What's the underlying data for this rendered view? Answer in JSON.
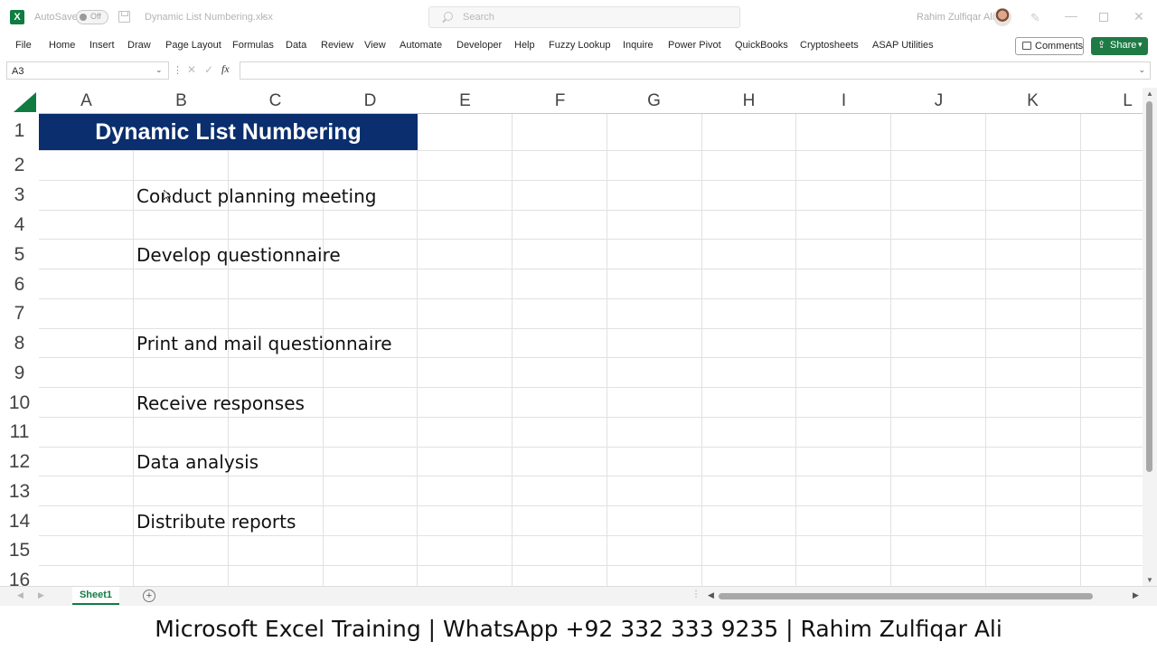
{
  "titlebar": {
    "autosave_label": "AutoSave",
    "autosave_state": "Off",
    "filename": "Dynamic List Numbering.xlsx",
    "search_placeholder": "Search",
    "username": "Rahim Zulfiqar Ali"
  },
  "ribbon": {
    "tabs": [
      "File",
      "Home",
      "Insert",
      "Draw",
      "Page Layout",
      "Formulas",
      "Data",
      "Review",
      "View",
      "Automate",
      "Developer",
      "Help",
      "Fuzzy Lookup",
      "Inquire",
      "Power Pivot",
      "QuickBooks",
      "Cryptosheets",
      "ASAP Utilities"
    ],
    "comments_label": "Comments",
    "share_label": "Share"
  },
  "formula_bar": {
    "name_box": "A3",
    "fx_label": "fx",
    "formula": ""
  },
  "sheet": {
    "columns": [
      "A",
      "B",
      "C",
      "D",
      "E",
      "F",
      "G",
      "H",
      "I",
      "J",
      "K",
      "L"
    ],
    "rows": [
      "1",
      "2",
      "3",
      "4",
      "5",
      "6",
      "7",
      "8",
      "9",
      "10",
      "11",
      "12",
      "13",
      "14",
      "15",
      "16"
    ],
    "title": "Dynamic List Numbering",
    "title_bg": "#0a2e6e",
    "tasks": [
      {
        "row": "3",
        "text": "Conduct planning meeting"
      },
      {
        "row": "5",
        "text": "Develop questionnaire"
      },
      {
        "row": "8",
        "text": "Print and mail questionnaire"
      },
      {
        "row": "10",
        "text": "Receive responses"
      },
      {
        "row": "12",
        "text": "Data analysis"
      },
      {
        "row": "14",
        "text": "Distribute reports"
      }
    ]
  },
  "tabs_bar": {
    "sheet_name": "Sheet1",
    "accent": "#107c41"
  },
  "banner": {
    "text": "Microsoft Excel Training | WhatsApp +92 332 333 9235 | Rahim Zulfiqar Ali"
  }
}
